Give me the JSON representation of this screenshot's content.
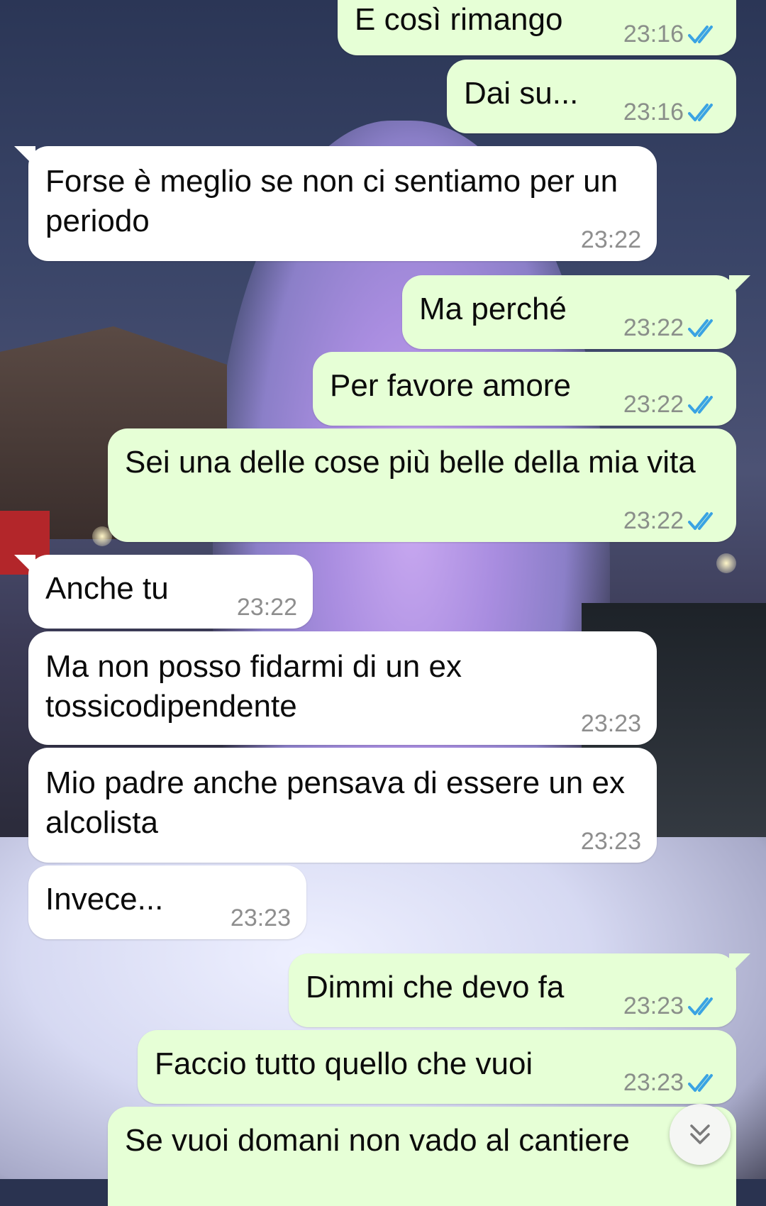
{
  "messages": [
    {
      "direction": "out",
      "text": "E così rimango",
      "time": "23:16",
      "status": "read"
    },
    {
      "direction": "out",
      "text": "Dai su...",
      "time": "23:16",
      "status": "read"
    },
    {
      "direction": "in",
      "text": "Forse è meglio se non ci sentiamo per un periodo",
      "time": "23:22"
    },
    {
      "direction": "out",
      "text": "Ma perché",
      "time": "23:22",
      "status": "read"
    },
    {
      "direction": "out",
      "text": "Per favore amore",
      "time": "23:22",
      "status": "read"
    },
    {
      "direction": "out",
      "text": "Sei una delle cose più belle della mia vita",
      "time": "23:22",
      "status": "read"
    },
    {
      "direction": "in",
      "text": "Anche tu",
      "time": "23:22"
    },
    {
      "direction": "in",
      "text": "Ma non posso fidarmi di un ex tossicodipendente",
      "time": "23:23"
    },
    {
      "direction": "in",
      "text": "Mio padre anche pensava di essere un ex alcolista",
      "time": "23:23"
    },
    {
      "direction": "in",
      "text": "Invece...",
      "time": "23:23"
    },
    {
      "direction": "out",
      "text": "Dimmi che devo fa",
      "time": "23:23",
      "status": "read"
    },
    {
      "direction": "out",
      "text": "Faccio tutto quello che vuoi",
      "time": "23:23",
      "status": "read"
    },
    {
      "direction": "out",
      "text": "Se vuoi domani non vado al cantiere",
      "time": ""
    }
  ],
  "colors": {
    "outgoing_bubble": "#e6ffd6",
    "incoming_bubble": "#ffffff",
    "read_tick": "#3aa3e3"
  },
  "icons": {
    "read_receipt": "double-check-icon",
    "scroll_down": "double-chevron-down-icon"
  }
}
